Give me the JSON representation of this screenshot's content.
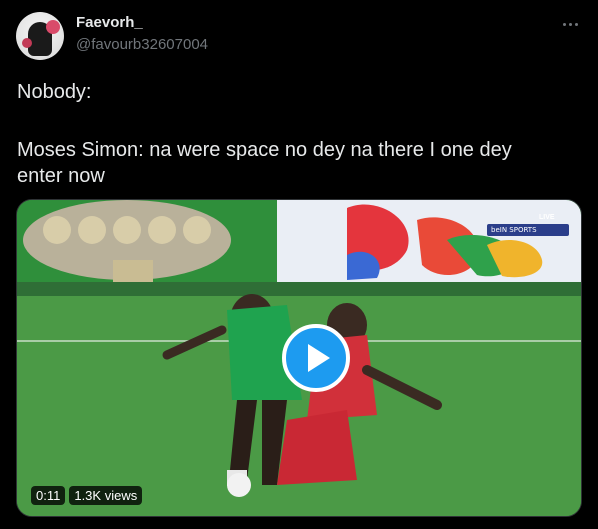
{
  "tweet": {
    "author": {
      "display_name": "Faevorh_",
      "handle": "@favourb32607004"
    },
    "text_line_1": "Nobody:",
    "text_line_2": "Moses Simon: na were space no dey na there I one dey",
    "text_line_3": "enter now",
    "media": {
      "type": "video",
      "duration": "0:11",
      "views": "1.3K views",
      "broadcaster": "beIN SPORTS",
      "live_label": "LIVE"
    }
  },
  "icons": {
    "more": "more-horizontal-icon",
    "play": "play-icon"
  },
  "colors": {
    "background": "#000000",
    "text_primary": "#e7e9ea",
    "text_secondary": "#71767b",
    "accent": "#1d9bf0"
  }
}
